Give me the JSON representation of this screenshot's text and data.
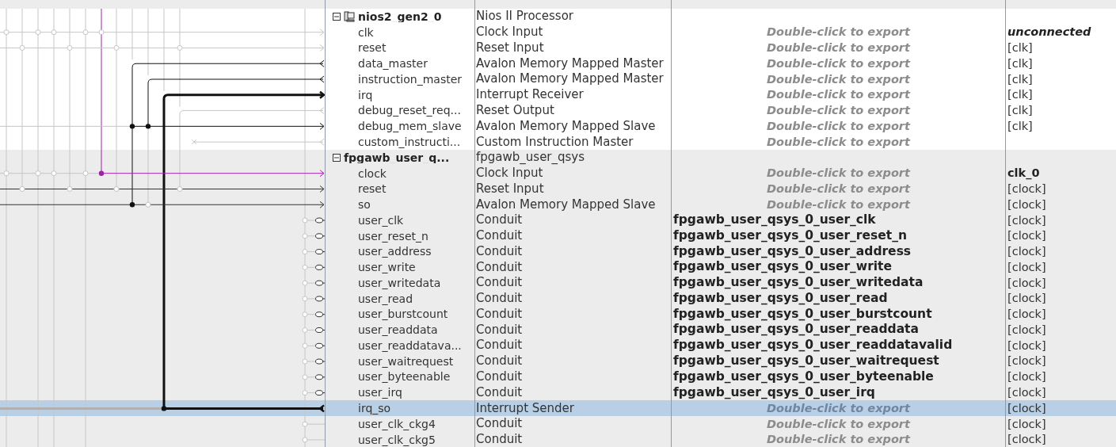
{
  "components": [
    {
      "name": "nios2_gen2_0",
      "kind": "processor",
      "description": "Nios II Processor",
      "expanded": true,
      "selected": false,
      "ports": [
        {
          "name": "clk",
          "description": "Clock Input",
          "export": {
            "text": "Double-click to export",
            "kind": "hint"
          },
          "clock": {
            "text": "unconnected",
            "kind": "unconnected"
          },
          "selected": false
        },
        {
          "name": "reset",
          "description": "Reset Input",
          "export": {
            "text": "Double-click to export",
            "kind": "hint"
          },
          "clock": {
            "text": "[clk]",
            "kind": "plain"
          },
          "selected": false
        },
        {
          "name": "data_master",
          "description": "Avalon Memory Mapped Master",
          "export": {
            "text": "Double-click to export",
            "kind": "hint"
          },
          "clock": {
            "text": "[clk]",
            "kind": "plain"
          },
          "selected": false
        },
        {
          "name": "instruction_master",
          "description": "Avalon Memory Mapped Master",
          "export": {
            "text": "Double-click to export",
            "kind": "hint"
          },
          "clock": {
            "text": "[clk]",
            "kind": "plain"
          },
          "selected": false
        },
        {
          "name": "irq",
          "description": "Interrupt Receiver",
          "export": {
            "text": "Double-click to export",
            "kind": "hint"
          },
          "clock": {
            "text": "[clk]",
            "kind": "plain"
          },
          "selected": false
        },
        {
          "name": "debug_reset_req...",
          "description": "Reset Output",
          "export": {
            "text": "Double-click to export",
            "kind": "hint"
          },
          "clock": {
            "text": "[clk]",
            "kind": "plain"
          },
          "selected": false
        },
        {
          "name": "debug_mem_slave",
          "description": "Avalon Memory Mapped Slave",
          "export": {
            "text": "Double-click to export",
            "kind": "hint"
          },
          "clock": {
            "text": "[clk]",
            "kind": "plain"
          },
          "selected": false
        },
        {
          "name": "custom_instructi...",
          "description": "Custom Instruction Master",
          "export": {
            "text": "Double-click to export",
            "kind": "hint"
          },
          "selected": false
        }
      ]
    },
    {
      "name": "fpgawb_user_q...",
      "kind": "module",
      "description": "fpgawb_user_qsys",
      "expanded": true,
      "selected": false,
      "ports": [
        {
          "name": "clock",
          "description": "Clock Input",
          "export": {
            "text": "Double-click to export",
            "kind": "hint"
          },
          "clock": {
            "text": "clk_0",
            "kind": "source"
          },
          "selected": false
        },
        {
          "name": "reset",
          "description": "Reset Input",
          "export": {
            "text": "Double-click to export",
            "kind": "hint"
          },
          "clock": {
            "text": "[clock]",
            "kind": "plain"
          },
          "selected": false
        },
        {
          "name": "so",
          "description": "Avalon Memory Mapped Slave",
          "export": {
            "text": "Double-click to export",
            "kind": "hint"
          },
          "clock": {
            "text": "[clock]",
            "kind": "plain"
          },
          "selected": false
        },
        {
          "name": "user_clk",
          "description": "Conduit",
          "export": {
            "text": "fpgawb_user_qsys_0_user_clk",
            "kind": "exported"
          },
          "clock": {
            "text": "[clock]",
            "kind": "plain"
          },
          "selected": false
        },
        {
          "name": "user_reset_n",
          "description": "Conduit",
          "export": {
            "text": "fpgawb_user_qsys_0_user_reset_n",
            "kind": "exported"
          },
          "clock": {
            "text": "[clock]",
            "kind": "plain"
          },
          "selected": false
        },
        {
          "name": "user_address",
          "description": "Conduit",
          "export": {
            "text": "fpgawb_user_qsys_0_user_address",
            "kind": "exported"
          },
          "clock": {
            "text": "[clock]",
            "kind": "plain"
          },
          "selected": false
        },
        {
          "name": "user_write",
          "description": "Conduit",
          "export": {
            "text": "fpgawb_user_qsys_0_user_write",
            "kind": "exported"
          },
          "clock": {
            "text": "[clock]",
            "kind": "plain"
          },
          "selected": false
        },
        {
          "name": "user_writedata",
          "description": "Conduit",
          "export": {
            "text": "fpgawb_user_qsys_0_user_writedata",
            "kind": "exported"
          },
          "clock": {
            "text": "[clock]",
            "kind": "plain"
          },
          "selected": false
        },
        {
          "name": "user_read",
          "description": "Conduit",
          "export": {
            "text": "fpgawb_user_qsys_0_user_read",
            "kind": "exported"
          },
          "clock": {
            "text": "[clock]",
            "kind": "plain"
          },
          "selected": false
        },
        {
          "name": "user_burstcount",
          "description": "Conduit",
          "export": {
            "text": "fpgawb_user_qsys_0_user_burstcount",
            "kind": "exported"
          },
          "clock": {
            "text": "[clock]",
            "kind": "plain"
          },
          "selected": false
        },
        {
          "name": "user_readdata",
          "description": "Conduit",
          "export": {
            "text": "fpgawb_user_qsys_0_user_readdata",
            "kind": "exported"
          },
          "clock": {
            "text": "[clock]",
            "kind": "plain"
          },
          "selected": false
        },
        {
          "name": "user_readdatava...",
          "description": "Conduit",
          "export": {
            "text": "fpgawb_user_qsys_0_user_readdatavalid",
            "kind": "exported"
          },
          "clock": {
            "text": "[clock]",
            "kind": "plain"
          },
          "selected": false
        },
        {
          "name": "user_waitrequest",
          "description": "Conduit",
          "export": {
            "text": "fpgawb_user_qsys_0_user_waitrequest",
            "kind": "exported"
          },
          "clock": {
            "text": "[clock]",
            "kind": "plain"
          },
          "selected": false
        },
        {
          "name": "user_byteenable",
          "description": "Conduit",
          "export": {
            "text": "fpgawb_user_qsys_0_user_byteenable",
            "kind": "exported"
          },
          "clock": {
            "text": "[clock]",
            "kind": "plain"
          },
          "selected": false
        },
        {
          "name": "user_irq",
          "description": "Conduit",
          "export": {
            "text": "fpgawb_user_qsys_0_user_irq",
            "kind": "exported"
          },
          "clock": {
            "text": "[clock]",
            "kind": "plain"
          },
          "selected": false
        },
        {
          "name": "irq_so",
          "description": "Interrupt Sender",
          "export": {
            "text": "Double-click to export",
            "kind": "hint"
          },
          "clock": {
            "text": "[clock]",
            "kind": "plain"
          },
          "selected": true
        },
        {
          "name": "user_clk_ckg4",
          "description": "Conduit",
          "export": {
            "text": "Double-click to export",
            "kind": "hint"
          },
          "clock": {
            "text": "[clock]",
            "kind": "plain"
          },
          "selected": false
        },
        {
          "name": "user_clk_ckg5",
          "description": "Conduit",
          "export": {
            "text": "Double-click to export",
            "kind": "hint"
          },
          "clock": {
            "text": "[clock]",
            "kind": "plain"
          },
          "selected": false
        }
      ]
    }
  ]
}
